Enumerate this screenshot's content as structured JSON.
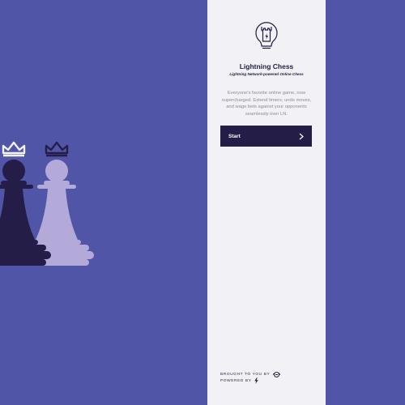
{
  "app": {
    "title": "Lightning Chess",
    "subtitle": "Lightning Network-powered Online Chess",
    "description": "Everyone's favorite online game, now supercharged. Extend timers, undo moves, and wage bets against your opponents seamlessly over LN.",
    "start_label": "Start",
    "brought_by_label": "BROUGHT TO YOU BY",
    "powered_by_label": "POWERED BY"
  },
  "icons": {
    "logo": "rook-bulb-icon",
    "start_arrow": "chevron-right-icon",
    "brought_by": "sponsor-logo-icon",
    "powered_by": "lightning-bolt-icon"
  },
  "colors": {
    "background": "#5155a8",
    "panel": "#f2f1f5",
    "button": "#231d47",
    "dark_pawn": "#231d47",
    "light_pawn": "#b3aad9"
  }
}
